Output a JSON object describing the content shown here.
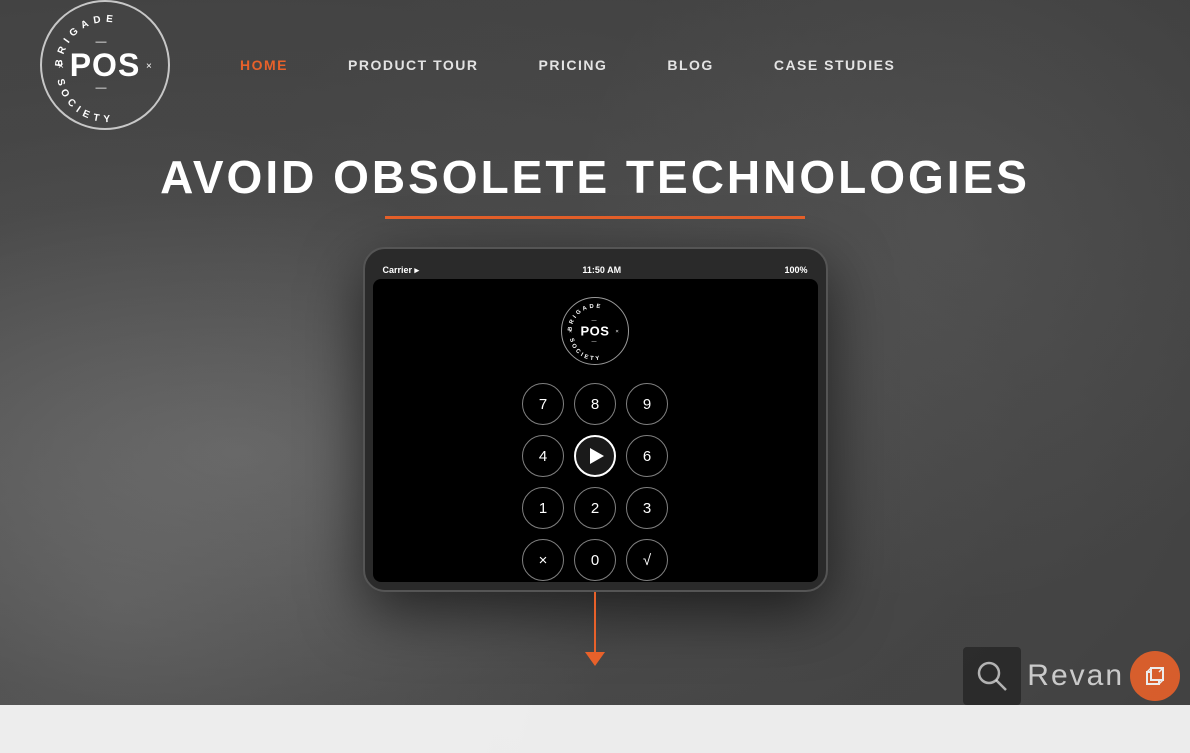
{
  "nav": {
    "links": [
      {
        "label": "HOME",
        "active": true,
        "id": "home"
      },
      {
        "label": "PRODUCT TOUR",
        "active": false,
        "id": "product-tour"
      },
      {
        "label": "PRICING",
        "active": false,
        "id": "pricing"
      },
      {
        "label": "BLOG",
        "active": false,
        "id": "blog"
      },
      {
        "label": "CASE STUDIES",
        "active": false,
        "id": "case-studies"
      }
    ]
  },
  "logo": {
    "pos_text": "POS",
    "dashes_top": "—",
    "dashes_bottom": "—",
    "ring_top": "BRIGADE",
    "ring_bottom": "SOCIETY",
    "crosses": "× ×"
  },
  "hero": {
    "title": "AVOID OBSOLETE TECHNOLOGIES",
    "underline_color": "#e8612a"
  },
  "ipad": {
    "status": {
      "carrier": "Carrier ▸",
      "time": "11:50 AM",
      "battery": "100%"
    },
    "screen_logo": {
      "pos": "POS",
      "dash_top": "—",
      "dash_bottom": "—"
    },
    "numpad_keys": [
      "7",
      "8",
      "9",
      "4",
      "▶",
      "6",
      "1",
      "2",
      "3",
      "×",
      "0",
      "√"
    ]
  },
  "watermark": {
    "text": "Revan",
    "icon_symbol": "⊙"
  },
  "colors": {
    "accent": "#e8612a",
    "nav_active": "#e8612a",
    "bg_dark": "#444",
    "text_light": "#ffffff"
  }
}
